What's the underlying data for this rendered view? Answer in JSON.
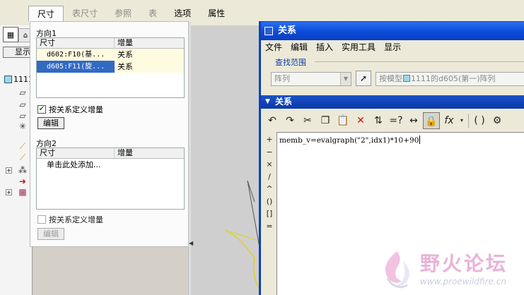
{
  "ribbon_tabs": [
    {
      "label": "尺寸",
      "state": "active"
    },
    {
      "label": "表尺寸",
      "state": "disabled"
    },
    {
      "label": "参照",
      "state": "disabled"
    },
    {
      "label": "表",
      "state": "disabled"
    },
    {
      "label": "选项",
      "state": "normal"
    },
    {
      "label": "属性",
      "state": "normal"
    }
  ],
  "model_tree": {
    "display_button": "显示",
    "root_label": "1111"
  },
  "dimension_panel": {
    "direction1": {
      "label": "方向1",
      "col_dim": "尺寸",
      "col_incr": "增量",
      "rows": [
        {
          "dim": "d602:F10(基...",
          "incr": "关系"
        },
        {
          "dim": "d605:F11(旋...",
          "incr": "关系"
        }
      ],
      "checkbox_label": "按关系定义增量",
      "checkbox_checked": true,
      "edit_label": "编辑"
    },
    "direction2": {
      "label": "方向2",
      "col_dim": "尺寸",
      "col_incr": "增量",
      "add_placeholder": "单击此处添加...",
      "checkbox_label": "按关系定义增量",
      "checkbox_checked": false,
      "edit_label": "编辑"
    }
  },
  "relations_dialog": {
    "title": "关系",
    "menu": [
      "文件",
      "编辑",
      "插入",
      "实用工具",
      "显示"
    ],
    "scope_label": "查找范围",
    "scope_value": "阵列",
    "model_prefix": "按模型",
    "model_value": "1111的d605(第一)阵列",
    "section_label": "关系",
    "side_ops": [
      "+",
      "−",
      "×",
      "/",
      "^",
      "()",
      "[]",
      "="
    ],
    "relation_text": "memb_v=evalgraph(\"2\",idx1)*10+90"
  },
  "watermark": {
    "text": "野火论坛",
    "url": "www.proewildfire.cn"
  },
  "colors": {
    "title_blue": "#0a3fc0",
    "selection_blue": "#316ac5",
    "watermark_pink": "#eab2d8"
  }
}
